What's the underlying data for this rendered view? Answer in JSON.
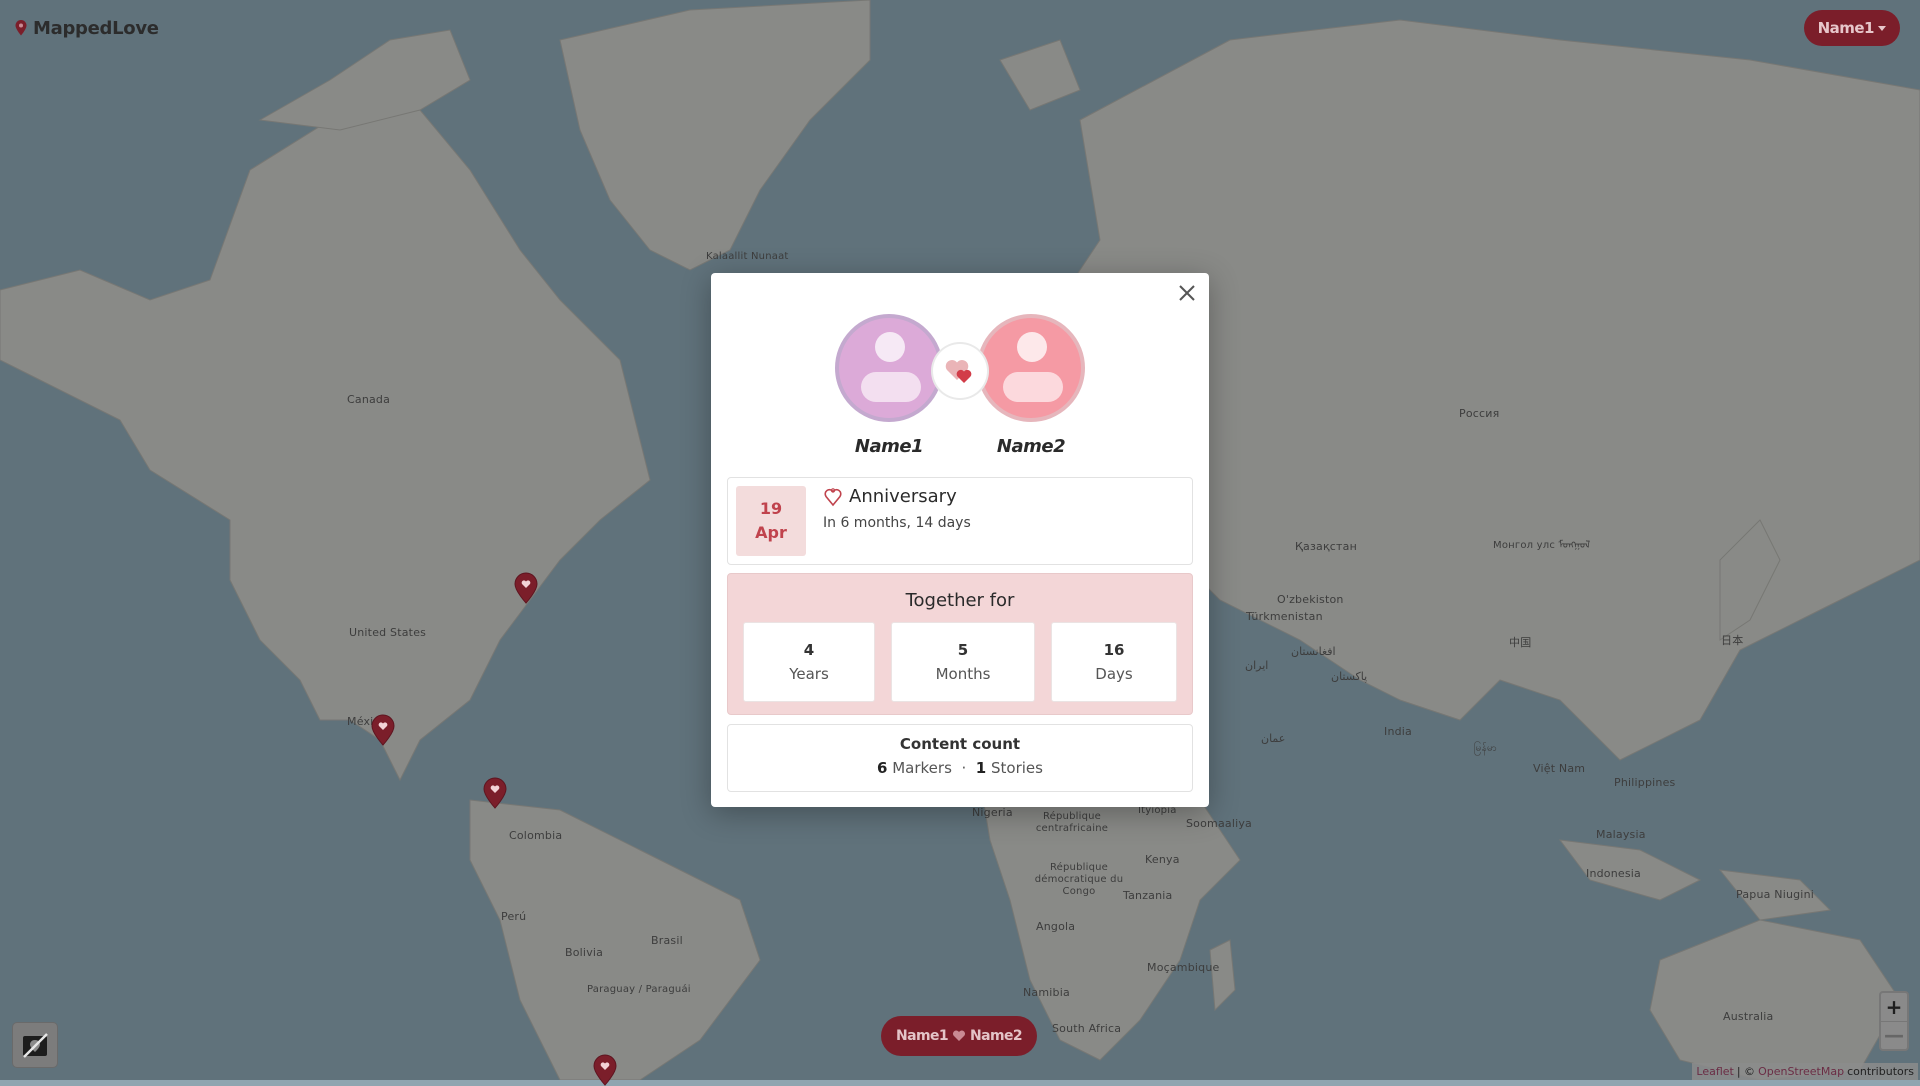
{
  "app": {
    "name": "MappedLove"
  },
  "user_menu": {
    "label": "Name1"
  },
  "map": {
    "labels": [
      "Kalaallit Nunaat",
      "Canada",
      "United States",
      "México",
      "Colombia",
      "Perú",
      "Brasil",
      "Bolivia",
      "Paraguay / Paraguái",
      "Россия",
      "Қазақстан",
      "Монгол улс ᠮᠣᠩᠭᠣᠯ",
      "O'zbekiston",
      "Türkmenistan",
      "افغانستان",
      "پاکستان",
      "ایران",
      "عمان",
      "中国",
      "日本",
      "India",
      "မြန်မာ",
      "Việt Nam",
      "Philippines",
      "Malaysia",
      "Indonesia",
      "Papua Niugini",
      "Australia",
      "Soomaaliya",
      "Kenya",
      "Tanzania",
      "Angola",
      "Namibia",
      "Moçambique",
      "South Africa",
      "République centrafricaine",
      "République démocratique du Congo",
      "Nigeria",
      "Ityiopia"
    ],
    "marker_count": 5
  },
  "modal": {
    "partner1": {
      "name": "Name1"
    },
    "partner2": {
      "name": "Name2"
    },
    "anniversary": {
      "day": "19",
      "month": "Apr",
      "title": "Anniversary",
      "subtitle": "In 6 months, 14 days"
    },
    "together": {
      "title": "Together for",
      "stats": [
        {
          "value": "4",
          "unit": "Years"
        },
        {
          "value": "5",
          "unit": "Months"
        },
        {
          "value": "16",
          "unit": "Days"
        }
      ]
    },
    "content_count": {
      "title": "Content count",
      "markers_value": "6",
      "markers_label": "Markers",
      "separator": "·",
      "stories_value": "1",
      "stories_label": "Stories"
    }
  },
  "couple_pill": {
    "name1": "Name1",
    "name2": "Name2"
  },
  "zoom": {
    "in": "+",
    "out": "—"
  },
  "attribution": {
    "leaflet": "Leaflet",
    "sep": "| ©",
    "osm": "OpenStreetMap",
    "suffix": "contributors"
  },
  "colors": {
    "brand": "#7b1e2a",
    "accent": "#c0434d",
    "pink_panel": "#f3d6d7"
  }
}
